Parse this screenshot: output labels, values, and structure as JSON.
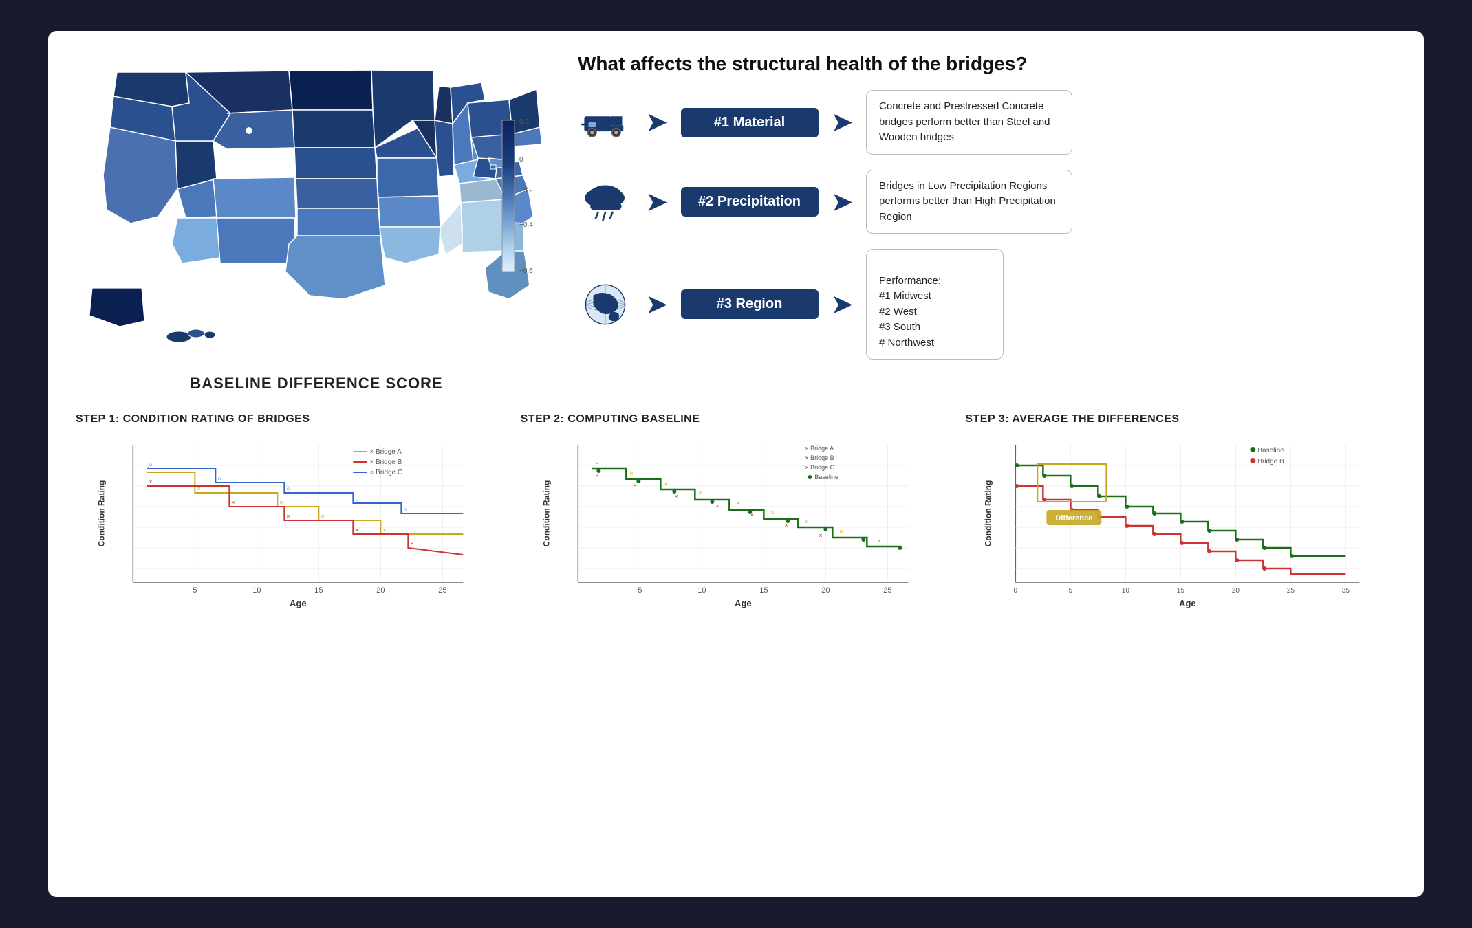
{
  "card": {
    "title": "What affects the structural health of the bridges?"
  },
  "map": {
    "title": "BASELINE DIFFERENCE SCORE",
    "legend_values": [
      "0.2",
      "0",
      "-0.2",
      "-0.4",
      "-0.6"
    ]
  },
  "factors": [
    {
      "rank": "#1 Material",
      "icon": "truck",
      "description": "Concrete and Prestressed Concrete bridges perform better than Steel and Wooden bridges"
    },
    {
      "rank": "#2 Precipitation",
      "icon": "cloud-rain",
      "description": "Bridges in Low Precipitation Regions performs better than High Precipitation Region"
    },
    {
      "rank": "#3 Region",
      "icon": "globe",
      "description": "Performance:\n#1 Midwest\n#2 West\n#3 South\n# Northwest"
    }
  ],
  "charts": [
    {
      "title": "STEP 1: CONDITION RATING OF BRIDGES",
      "x_label": "Age",
      "y_label": "Condition Rating",
      "legend": [
        "Bridge A",
        "Bridge B",
        "Bridge C"
      ]
    },
    {
      "title": "STEP 2: COMPUTING BASELINE",
      "x_label": "Age",
      "y_label": "Condition Rating",
      "legend": [
        "Bridge A",
        "Bridge B",
        "Bridge C",
        "Baseline"
      ]
    },
    {
      "title": "STEP 3: AVERAGE THE DIFFERENCES",
      "x_label": "Age",
      "y_label": "Condition Rating",
      "legend": [
        "Baseline",
        "Bridge B"
      ],
      "annotation": "Difference"
    }
  ]
}
